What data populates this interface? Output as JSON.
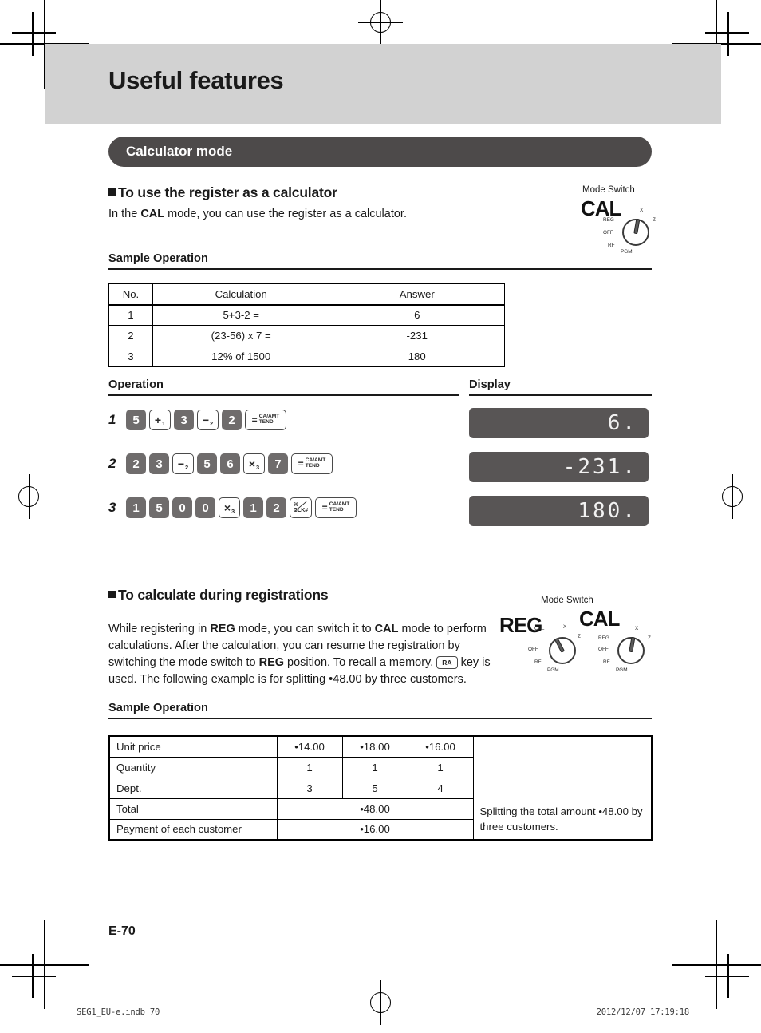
{
  "page": {
    "banner_title": "Useful features",
    "section_bar": "Calculator mode",
    "page_number": "E-70"
  },
  "section1": {
    "heading": "To use the register as a calculator",
    "intro_pre": "In the ",
    "intro_bold": "CAL",
    "intro_post": " mode, you can use the register as a calculator.",
    "sample_label": "Sample Operation",
    "operation_label": "Operation",
    "display_label": "Display",
    "mode_switch": {
      "title": "Mode Switch",
      "big_label": "CAL",
      "labels": [
        "X",
        "Z",
        "REG",
        "OFF",
        "RF",
        "PGM"
      ]
    },
    "table": {
      "headers": [
        "No.",
        "Calculation",
        "Answer"
      ],
      "rows": [
        [
          "1",
          "5+3-2 =",
          "6"
        ],
        [
          "2",
          "(23-56) x 7 =",
          "-231"
        ],
        [
          "3",
          "12% of 1500",
          "180"
        ]
      ]
    },
    "steps": [
      {
        "num": "1",
        "keys": [
          {
            "type": "num",
            "label": "5"
          },
          {
            "type": "op",
            "glyph": "+",
            "sub": "1"
          },
          {
            "type": "num",
            "label": "3"
          },
          {
            "type": "op",
            "glyph": "−",
            "sub": "2"
          },
          {
            "type": "num",
            "label": "2"
          },
          {
            "type": "tend",
            "eq": "=",
            "top": "CA/AMT",
            "bottom": "TEND"
          }
        ],
        "display": "6."
      },
      {
        "num": "2",
        "keys": [
          {
            "type": "num",
            "label": "2"
          },
          {
            "type": "num",
            "label": "3"
          },
          {
            "type": "op",
            "glyph": "−",
            "sub": "2"
          },
          {
            "type": "num",
            "label": "5"
          },
          {
            "type": "num",
            "label": "6"
          },
          {
            "type": "op",
            "glyph": "×",
            "sub": "3"
          },
          {
            "type": "num",
            "label": "7"
          },
          {
            "type": "tend",
            "eq": "=",
            "top": "CA/AMT",
            "bottom": "TEND"
          }
        ],
        "display": "-231."
      },
      {
        "num": "3",
        "keys": [
          {
            "type": "num",
            "label": "1"
          },
          {
            "type": "num",
            "label": "5"
          },
          {
            "type": "num",
            "label": "0"
          },
          {
            "type": "num",
            "label": "0"
          },
          {
            "type": "op",
            "glyph": "×",
            "sub": "3"
          },
          {
            "type": "num",
            "label": "1"
          },
          {
            "type": "num",
            "label": "2"
          },
          {
            "type": "pct",
            "top": "%",
            "bottom": "CLK#"
          },
          {
            "type": "tend",
            "eq": "=",
            "top": "CA/AMT",
            "bottom": "TEND"
          }
        ],
        "display": "180."
      }
    ]
  },
  "section2": {
    "heading": "To calculate during registrations",
    "paragraph": {
      "p1": "While registering in ",
      "b1": "REG",
      "p2": " mode, you can switch it to ",
      "b2": "CAL",
      "p3": " mode to perform calculations. After the calculation, you can resume the registration by switching the mode switch to ",
      "b3": "REG",
      "p4": " position. To recall a memory, ",
      "key": "RA",
      "p5": " key is used. The following example is for splitting •48.00 by three customers."
    },
    "sample_label": "Sample Operation",
    "mode_switch": {
      "title": "Mode Switch",
      "big_label_left": "REG",
      "big_label_right": "CAL",
      "labels_left": [
        "CAL",
        "X",
        "Z",
        "OFF",
        "RF",
        "PGM"
      ],
      "labels_right": [
        "X",
        "Z",
        "REG",
        "OFF",
        "RF",
        "PGM"
      ]
    },
    "table": {
      "rows": [
        {
          "label": "Unit price",
          "values": [
            "•14.00",
            "•18.00",
            "•16.00"
          ]
        },
        {
          "label": "Quantity",
          "values": [
            "1",
            "1",
            "1"
          ]
        },
        {
          "label": "Dept.",
          "values": [
            "3",
            "5",
            "4"
          ]
        }
      ],
      "total_label": "Total",
      "total_value": "•48.00",
      "payment_label": "Payment of each customer",
      "payment_value": "•16.00",
      "note": "Splitting the total amount •48.00 by three customers."
    }
  },
  "print_footer": {
    "left": "SEG1_EU-e.indb   70",
    "right": "2012/12/07   17:19:18"
  }
}
